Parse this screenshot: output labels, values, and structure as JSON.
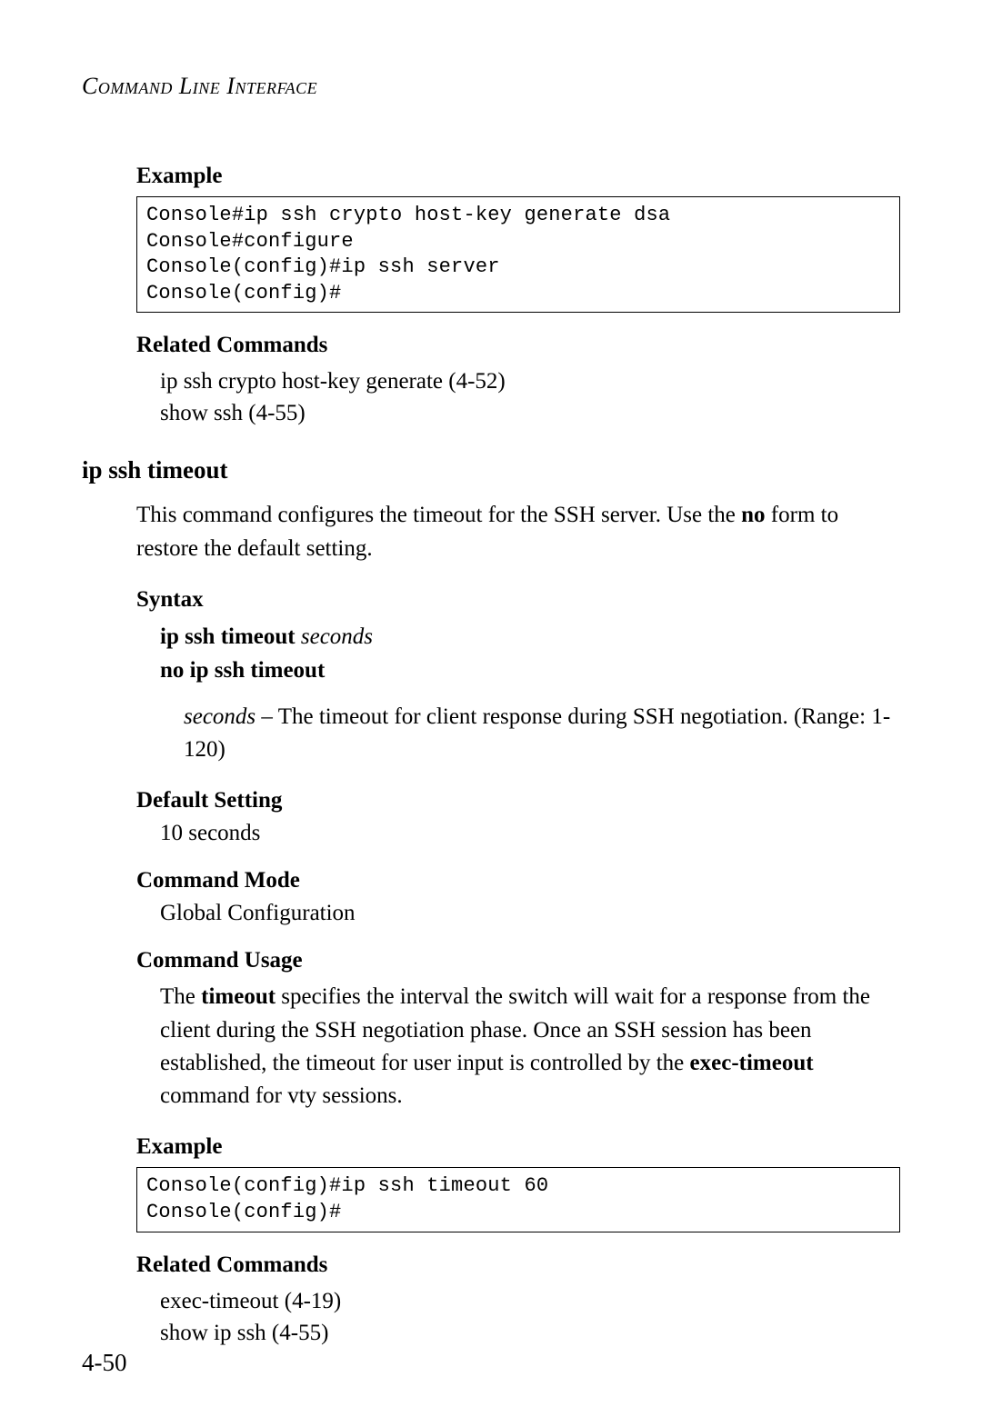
{
  "running_head": "Command Line Interface",
  "example1": {
    "label": "Example",
    "code": "Console#ip ssh crypto host-key generate dsa\nConsole#configure\nConsole(config)#ip ssh server\nConsole(config)#"
  },
  "related1": {
    "label": "Related Commands",
    "items": [
      "ip ssh crypto host-key generate (4-52)",
      "show ssh (4-55)"
    ]
  },
  "section": {
    "title": "ip ssh timeout",
    "intro_before_bold": "This command configures the timeout for the SSH server. Use the ",
    "intro_bold": "no",
    "intro_after_bold": " form to restore the default setting."
  },
  "syntax": {
    "label": "Syntax",
    "line1_cmd": "ip ssh timeout",
    "line1_arg": "seconds",
    "line2_cmd": "no ip ssh timeout",
    "param_arg": "seconds",
    "param_desc": " – The timeout for client response during SSH negotiation. (Range: 1-120)"
  },
  "default_setting": {
    "label": "Default Setting",
    "value": "10 seconds"
  },
  "command_mode": {
    "label": "Command Mode",
    "value": "Global Configuration"
  },
  "command_usage": {
    "label": "Command Usage",
    "pre1": "The ",
    "bold1": "timeout",
    "mid": " specifies the interval the switch will wait for a response from the client during the SSH negotiation phase. Once an SSH session has been established, the timeout for user input is controlled by the ",
    "bold2": "exec-timeout",
    "post": " command for vty sessions."
  },
  "example2": {
    "label": "Example",
    "code": "Console(config)#ip ssh timeout 60\nConsole(config)#"
  },
  "related2": {
    "label": "Related Commands",
    "items": [
      "exec-timeout (4-19)",
      "show ip ssh (4-55)"
    ]
  },
  "page_number": "4-50"
}
